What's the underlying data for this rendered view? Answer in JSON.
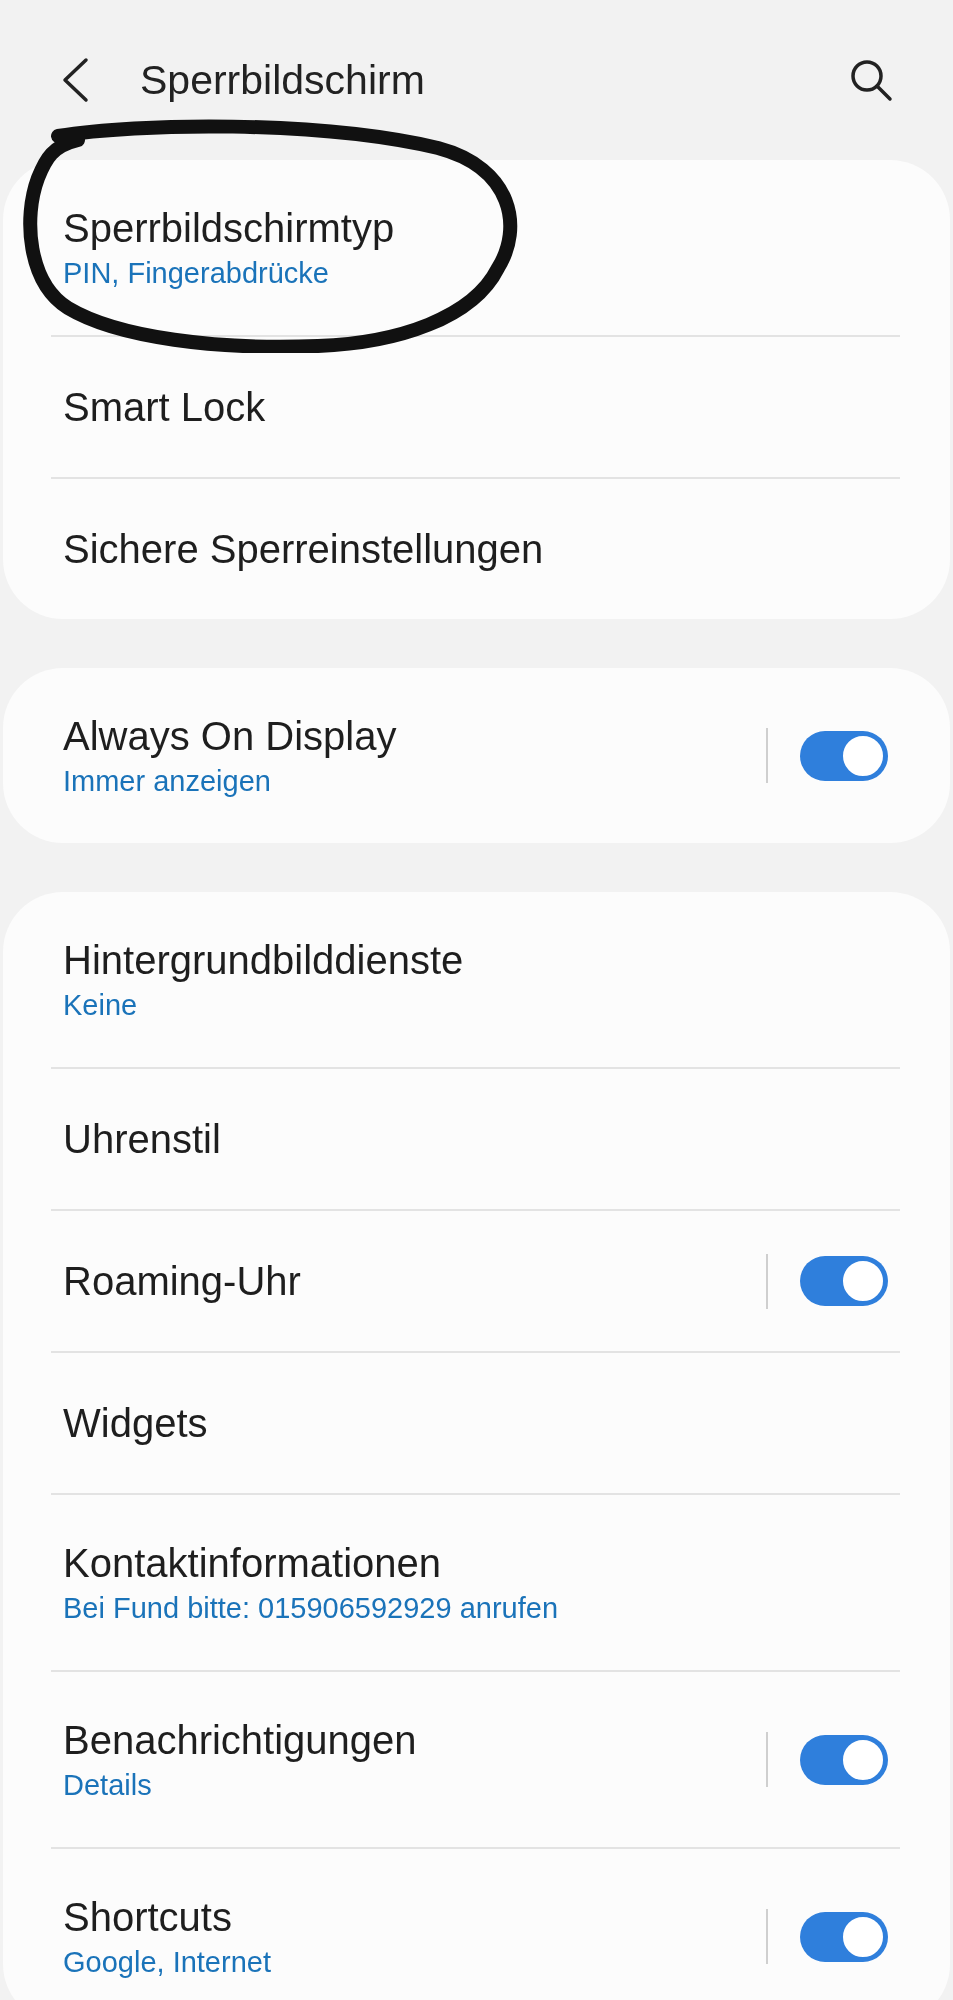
{
  "header": {
    "title": "Sperrbildschirm"
  },
  "groups": [
    {
      "items": [
        {
          "kind": "link",
          "title": "Sperrbildschirmtyp",
          "subtitle": "PIN, Fingerabdrücke"
        },
        {
          "kind": "link",
          "title": "Smart Lock"
        },
        {
          "kind": "link",
          "title": "Sichere Sperreinstellungen"
        }
      ]
    },
    {
      "items": [
        {
          "kind": "toggle",
          "title": "Always On Display",
          "subtitle": "Immer anzeigen",
          "on": true
        }
      ]
    },
    {
      "items": [
        {
          "kind": "link",
          "title": "Hintergrundbilddienste",
          "subtitle": "Keine"
        },
        {
          "kind": "link",
          "title": "Uhrenstil"
        },
        {
          "kind": "toggle",
          "title": "Roaming-Uhr",
          "on": true
        },
        {
          "kind": "link",
          "title": "Widgets"
        },
        {
          "kind": "link",
          "title": "Kontaktinformationen",
          "subtitle": "Bei Fund bitte: 015906592929 anrufen"
        },
        {
          "kind": "toggle",
          "title": "Benachrichtigungen",
          "subtitle": "Details",
          "on": true
        },
        {
          "kind": "toggle",
          "title": "Shortcuts",
          "subtitle": "Google, Internet",
          "on": true
        }
      ]
    }
  ]
}
